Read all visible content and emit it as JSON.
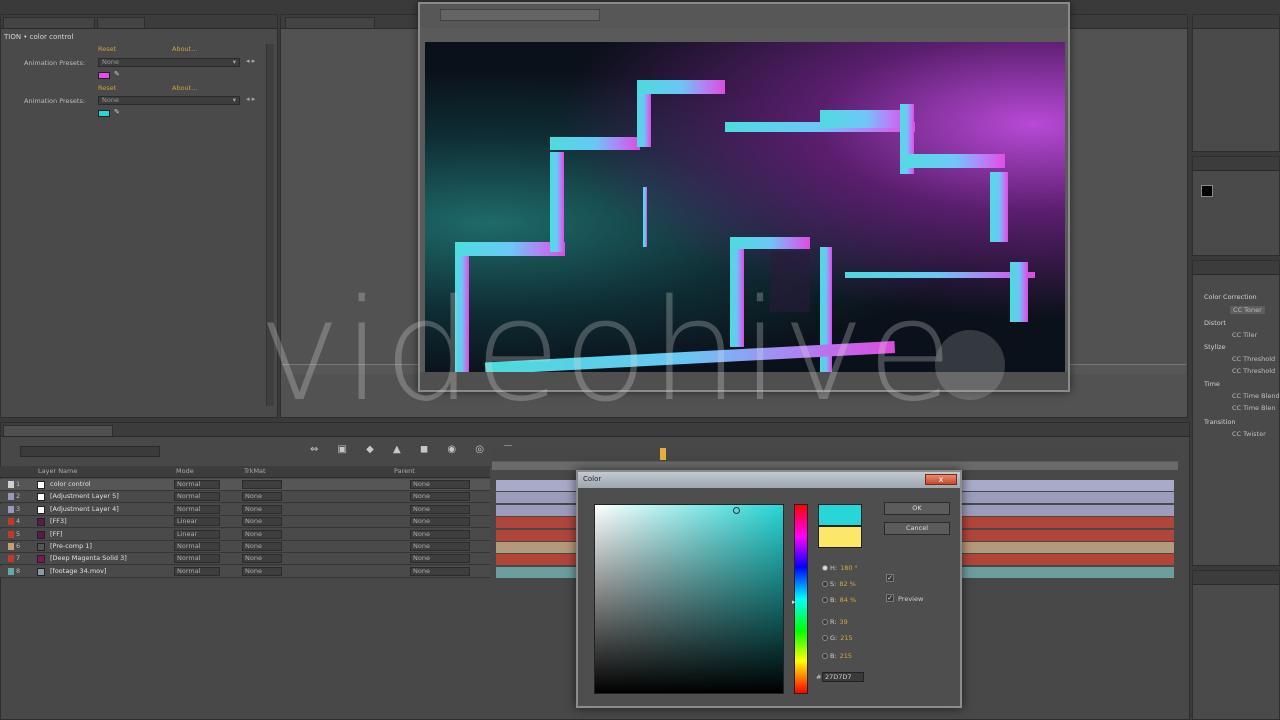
{
  "colors": {
    "magenta": "#e24ee6",
    "cyan": "#27d7d7",
    "yellow": "#fce866",
    "orange": "#d9a640"
  },
  "effect_controls": {
    "title": "TION • color control",
    "rows": [
      {
        "reset": "Reset",
        "about": "About...",
        "label": "Animation Presets:",
        "preset": "None",
        "swatch": "#e24ee6"
      },
      {
        "reset": "Reset",
        "about": "About...",
        "label": "Animation Presets:",
        "preset": "None",
        "swatch": "#27d7d7"
      }
    ]
  },
  "watermark": "videohive",
  "effects_presets": {
    "categories": [
      {
        "name": "Color Correction",
        "items": [
          "CC Toner"
        ]
      },
      {
        "name": "Distort",
        "items": [
          "CC Tiler"
        ]
      },
      {
        "name": "Stylize",
        "items": [
          "CC Threshold",
          "CC Threshold"
        ]
      },
      {
        "name": "Time",
        "items": [
          "CC Time Blend",
          "CC Time Blen"
        ]
      },
      {
        "name": "Transition",
        "items": [
          "CC Twister"
        ]
      }
    ]
  },
  "timeline": {
    "columns": {
      "layer_name": "Layer Name",
      "mode": "Mode",
      "trkmat": "TrkMat",
      "parent": "Parent"
    },
    "layers": [
      {
        "num": "1",
        "name": "color control",
        "mode": "Normal",
        "trkmat": "",
        "parent": "None",
        "label": "#d0d0d0",
        "box": "#ffffff",
        "bar": "#a9a9c9"
      },
      {
        "num": "2",
        "name": "[Adjustment Layer 5]",
        "mode": "Normal",
        "trkmat": "None",
        "parent": "None",
        "label": "#9999bb",
        "box": "#ffffff",
        "bar": "#9c9cbd"
      },
      {
        "num": "3",
        "name": "[Adjustment Layer 4]",
        "mode": "Normal",
        "trkmat": "None",
        "parent": "None",
        "label": "#9999bb",
        "box": "#ffffff",
        "bar": "#9c9cbd"
      },
      {
        "num": "4",
        "name": "[FF3]",
        "mode": "Linear",
        "trkmat": "None",
        "parent": "None",
        "label": "#c0392b",
        "box": "#5a1a4a",
        "bar": "#b2453a"
      },
      {
        "num": "5",
        "name": "[FF]",
        "mode": "Linear",
        "trkmat": "None",
        "parent": "None",
        "label": "#c0392b",
        "box": "#5a1a4a",
        "bar": "#b2453a"
      },
      {
        "num": "6",
        "name": "[Pre-comp 1]",
        "mode": "Normal",
        "trkmat": "None",
        "parent": "None",
        "label": "#c8a070",
        "box": "#555555",
        "bar": "#b39a7c"
      },
      {
        "num": "7",
        "name": "[Deep Magenta Solid 3]",
        "mode": "Normal",
        "trkmat": "None",
        "parent": "None",
        "label": "#c0392b",
        "box": "#7a1a5a",
        "bar": "#b2453a"
      },
      {
        "num": "8",
        "name": "[footage 34.mov]",
        "mode": "Normal",
        "trkmat": "None",
        "parent": "None",
        "label": "#6aa6a6",
        "box": "#8a9aa4",
        "bar": "#6c9e9e"
      }
    ]
  },
  "color_dialog": {
    "title": "Color",
    "close": "x",
    "ok": "OK",
    "cancel": "Cancel",
    "preview": "Preview",
    "new_color": "#27d7d7",
    "old_color": "#fce866",
    "values": [
      {
        "label": "H:",
        "value": "180 °",
        "selected": true
      },
      {
        "label": "S:",
        "value": "82 %",
        "selected": false
      },
      {
        "label": "B:",
        "value": "84 %",
        "selected": false
      },
      {
        "label": "R:",
        "value": "39",
        "selected": false
      },
      {
        "label": "G:",
        "value": "215",
        "selected": false
      },
      {
        "label": "B:",
        "value": "215",
        "selected": false
      }
    ],
    "hex": "27D7D7"
  }
}
